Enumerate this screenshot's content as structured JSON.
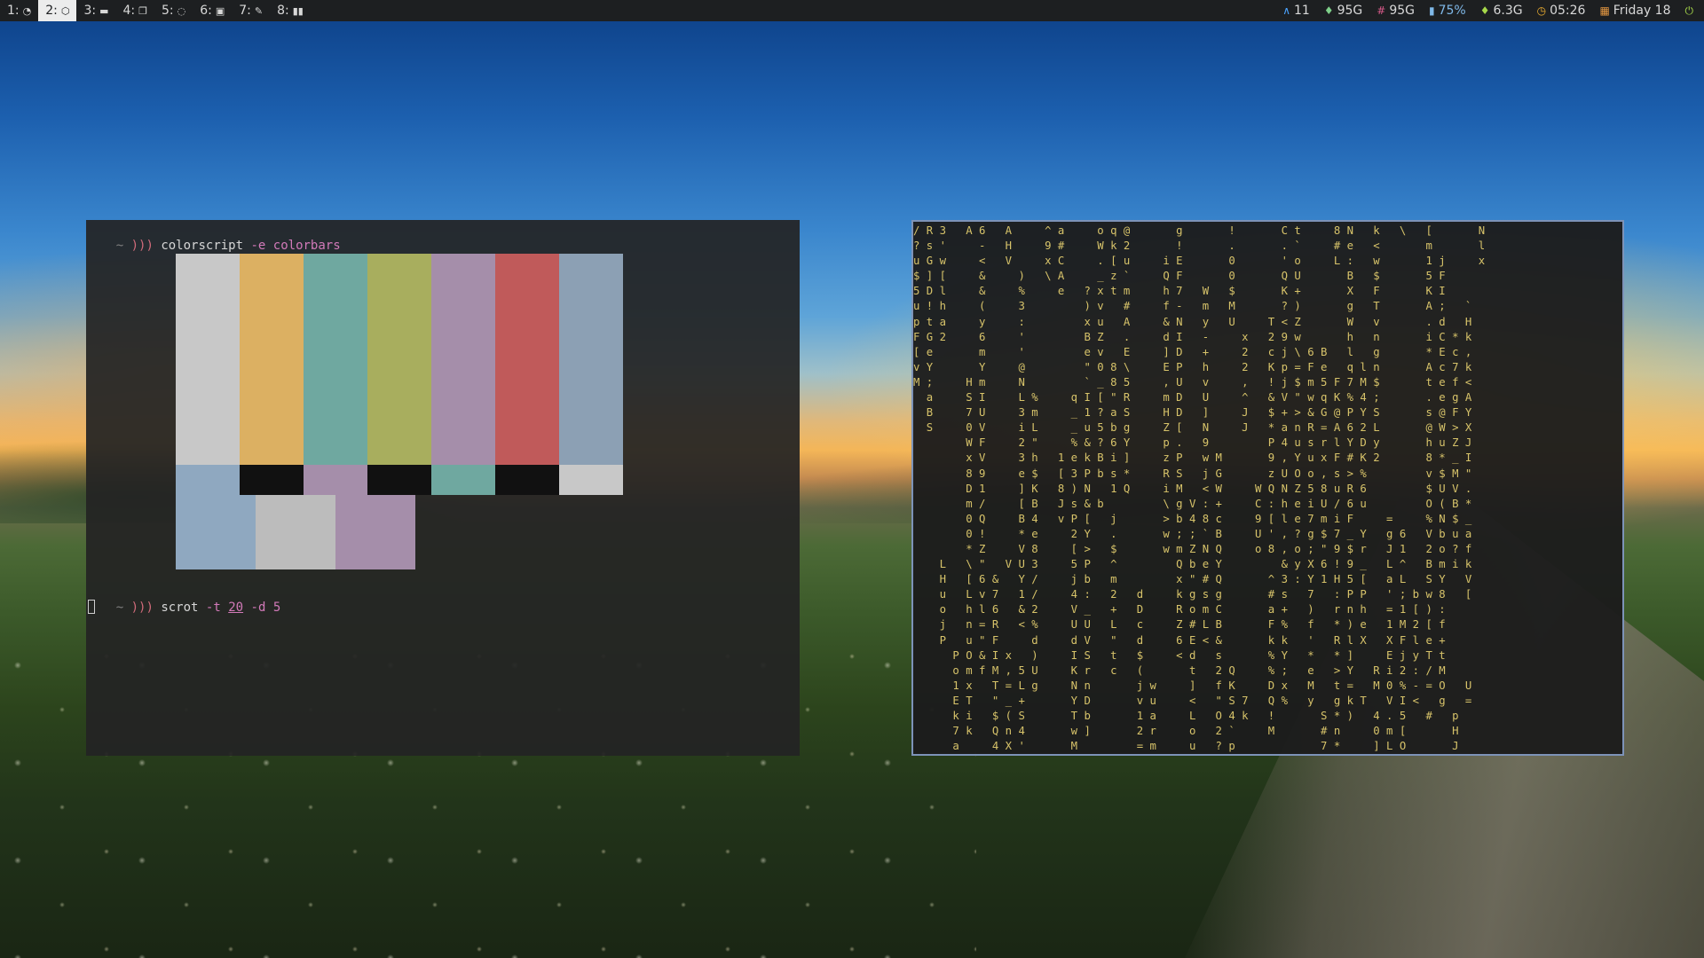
{
  "workspaces": [
    {
      "label": "1:",
      "icon": "clock-icon",
      "glyph": "◔",
      "active": false
    },
    {
      "label": "2:",
      "icon": "codepen-icon",
      "glyph": "⬡",
      "active": true
    },
    {
      "label": "3:",
      "icon": "envelope-icon",
      "glyph": "▬",
      "active": false
    },
    {
      "label": "4:",
      "icon": "copy-icon",
      "glyph": "❐",
      "active": false
    },
    {
      "label": "5:",
      "icon": "chat-icon",
      "glyph": "◌",
      "active": false
    },
    {
      "label": "6:",
      "icon": "image-icon",
      "glyph": "▣",
      "active": false
    },
    {
      "label": "7:",
      "icon": "pencil-icon",
      "glyph": "✎",
      "active": false
    },
    {
      "label": "8:",
      "icon": "media-icon",
      "glyph": "▮▮",
      "active": false
    }
  ],
  "status": [
    {
      "icon": "arrow-up-icon",
      "glyph": "∧",
      "value": "11",
      "color": "#4aa3ff"
    },
    {
      "icon": "disk-icon",
      "glyph": "♦",
      "value": "95G",
      "color": "#7fd08a"
    },
    {
      "icon": "hash-icon",
      "glyph": "#",
      "value": "95G",
      "color": "#d85a8a"
    },
    {
      "icon": "battery-icon",
      "glyph": "▮",
      "value": "75%",
      "color": "#7fb8e8"
    },
    {
      "icon": "memory-icon",
      "glyph": "♦",
      "value": "6.3G",
      "color": "#a6d84a"
    },
    {
      "icon": "clock-icon",
      "glyph": "◷",
      "value": "05:26",
      "color": "#f0b030"
    },
    {
      "icon": "calendar-icon",
      "glyph": "▦",
      "value": "Friday 18",
      "color": "#e09540"
    },
    {
      "icon": "power-icon",
      "glyph": "⏻",
      "value": "",
      "color": "#a6d84a"
    }
  ],
  "terminal_left": {
    "prompt_tilde": "~",
    "prompt_arrows": ")))",
    "cmd1": {
      "program": "colorscript",
      "flag": "-e",
      "arg": "colorbars"
    },
    "cmd2": {
      "program": "scrot",
      "flag1": "-t",
      "num1": "20",
      "flag2": "-d",
      "num2": "5"
    },
    "colorbars": {
      "top": [
        "#c8c8c8",
        "#dcb062",
        "#6fa8a0",
        "#a8ae5e",
        "#a58eaa",
        "#c05a5a",
        "#8ca0b4"
      ],
      "middle": [
        "#8fa8c0",
        "#111111",
        "#a58eaa",
        "#111111",
        "#6fa8a0",
        "#111111",
        "#c8c8c8"
      ],
      "bottom": [
        "#8fa8c0",
        "#bcbcbc",
        "#a58eaa"
      ]
    }
  },
  "terminal_right": {
    "matrix_lines": [
      "/ R 3   A 6   A     ^ a     o q @       g       !       C t     8 N   k   \\   [       N",
      "? s '     -   H     9 #     W k 2       !       .       . `     # e   <       m       l",
      "u G w     <   V     x C     . [ u     i E       0       ' o     L :   w       1 j     x",
      "$ ] [     &     )   \\ A     _ z `     Q F       0       Q U       B   $       5 F      ",
      "5 D l     &     %     e   ? x t m     h 7   W   $       K +       X   F       K I      ",
      "u ! h     (     3         ) v   #     f -   m   M       ? )       g   T       A ;   `  ",
      "p t a     y     :         x u   A     & N   y   U     T < Z       W   v       . d   H  ",
      "F G 2     6     '         B Z   .     d I   -     x   2 9 w       h   n       i C * k  ",
      "[ e       m     '         e v   E     ] D   +     2   c j \\ 6 B   l   g       * E c ,  ",
      "v Y       Y     @         \" 0 8 \\     E P   h     2   K p = F e   q l n       A c 7 k  ",
      "M ;     H m     N         ` _ 8 5     , U   v     ,   ! j $ m 5 F 7 M $       t e f <  ",
      "  a     S I     L %     q I [ \" R     m D   U     ^   & V \" w q K % 4 ;       . e g A  ",
      "  B     7 U     3 m     _ 1 ? a S     H D   ]     J   $ + > & G @ P Y S       s @ F Y  ",
      "  S     0 V     i L     _ u 5 b g     Z [   N     J   * a n R = A 6 2 L       @ W > X  ",
      "        W F     2 \"     % & ? 6 Y     p .   9         P 4 u s r l Y D y       h u Z J  ",
      "        x V     3 h   1 e k B i ]     z P   w M       9 , Y u x F # K 2       8 * _ I  ",
      "        8 9     e $   [ 3 P b s *     R S   j G       z U O o , s > %         v $ M \"  ",
      "        D 1     ] K   8 ) N   1 Q     i M   < W     W Q N Z 5 8 u R 6         $ U V .  ",
      "        m /     [ B   J s & b         \\ g V : +     C : h e i U / 6 u         O ( B *  ",
      "        0 Q     B 4   v P [   j       > b 4 8 c     9 [ l e 7 m i F     =     % N $ _  ",
      "        0 !     * e     2 Y   .       w ; ; ` B     U ' , ? g $ 7 _ Y   g 6   V b u a  ",
      "        * Z     V 8     [ >   $       w m Z N Q     o 8 , o ; \" 9 $ r   J 1   2 o ? f  ",
      "    L   \\ \"   V U 3     5 P   ^         Q b e Y         & y X 6 ! 9 _   L ^   B m i k  ",
      "    H   [ 6 &   Y /     j b   m         x \" # Q       ^ 3 : Y 1 H 5 [   a L   S Y   V  ",
      "    u   L v 7   1 /     4 :   2   d     k g s g       # s   7   : P P   ' ; b w 8   [  ",
      "    o   h l 6   & 2     V _   +   D     R o m C       a +   )   r n h   = 1 [ ) :      ",
      "    j   n = R   < %     U U   L   c     Z # L B       F %   f   * ) e   1 M 2 [ f      ",
      "    P   u \" F     d     d V   \"   d     6 E < &       k k   '   R l X   X F l e +      ",
      "      P O & I x   )     I S   t   $     < d   s       % Y   *   * ]     E j y T t      ",
      "      o m f M , 5 U     K r   c   (       t   2 Q     % ;   e   > Y   R i 2 : / M      ",
      "      1 x   T = L g     N n       j w     ]   f K     D x   M   t =   M 0 % - = O   U  ",
      "      E T   \" _ +       Y D       v u     <   \" S 7   Q %   y   g k T   V I <   g   =  ",
      "      k i   $ ( S       T b       1 a     L   O 4 k   !       S * )   4 . 5   #   p  ",
      "      7 k   Q n 4       w ]       2 r     o   2 `     M       # n     0 m [       H  ",
      "      a     4 X '       M         = m     u   ? p             7 *     ] L O       J  "
    ]
  }
}
